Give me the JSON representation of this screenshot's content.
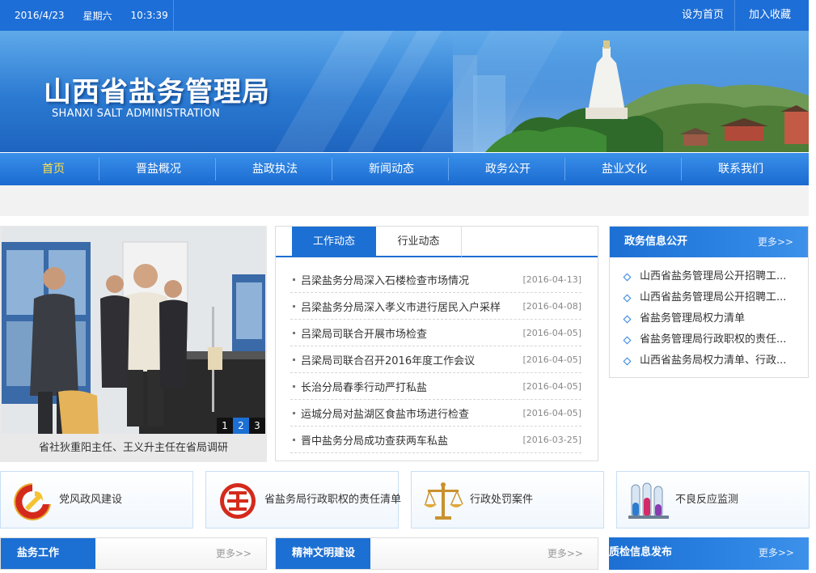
{
  "topbar": {
    "date": "2016/4/23",
    "weekday": "星期六",
    "time": "10:3:39",
    "set_homepage": "设为首页",
    "add_favorite": "加入收藏"
  },
  "banner": {
    "title": "山西省盐务管理局",
    "subtitle": "SHANXI SALT ADMINISTRATION"
  },
  "nav": {
    "items": [
      "首页",
      "晋盐概况",
      "盐政执法",
      "新闻动态",
      "政务公开",
      "盐业文化",
      "联系我们"
    ],
    "active_index": 0
  },
  "slideshow": {
    "caption": "省社狄重阳主任、王义升主任在省局调研",
    "pages": [
      "1",
      "2",
      "3"
    ],
    "active_page": 1
  },
  "news": {
    "tabs": [
      "工作动态",
      "行业动态"
    ],
    "active_tab": 0,
    "items": [
      {
        "title": "吕梁盐务分局深入石楼检查市场情况",
        "date": "[2016-04-13]"
      },
      {
        "title": "吕梁盐务分局深入孝义市进行居民入户采样",
        "date": "[2016-04-08]"
      },
      {
        "title": "吕梁局司联合开展市场检查",
        "date": "[2016-04-05]"
      },
      {
        "title": "吕梁局司联合召开2016年度工作会议",
        "date": "[2016-04-05]"
      },
      {
        "title": "长治分局春季行动严打私盐",
        "date": "[2016-04-05]"
      },
      {
        "title": "运城分局对盐湖区食盐市场进行检查",
        "date": "[2016-04-05]"
      },
      {
        "title": "晋中盐务分局成功查获两车私盐",
        "date": "[2016-03-25]"
      }
    ]
  },
  "info_panel": {
    "title": "政务信息公开",
    "more": "更多>>",
    "items": [
      "山西省盐务管理局公开招聘工...",
      "山西省盐务管理局公开招聘工...",
      "省盐务管理局权力清单",
      "省盐务管理局行政职权的责任...",
      "山西省盐务局权力清单、行政..."
    ]
  },
  "quick_links": [
    {
      "label": "党风政风建设",
      "icon": "party-emblem-icon"
    },
    {
      "label": "省盐务局行政职权的责任清单",
      "icon": "salt-seal-icon"
    },
    {
      "label": "行政处罚案件",
      "icon": "scales-icon"
    },
    {
      "label": "不良反应监测",
      "icon": "test-tubes-icon"
    }
  ],
  "bottom_panels": [
    {
      "title": "盐务工作",
      "more": "更多>>"
    },
    {
      "title": "精神文明建设",
      "more": "更多>>"
    },
    {
      "title": "质检信息发布",
      "more": "更多>>"
    }
  ],
  "colors": {
    "primary": "#1c6fd3",
    "nav_active": "#ffe14a",
    "accent_red": "#d42a1c"
  }
}
